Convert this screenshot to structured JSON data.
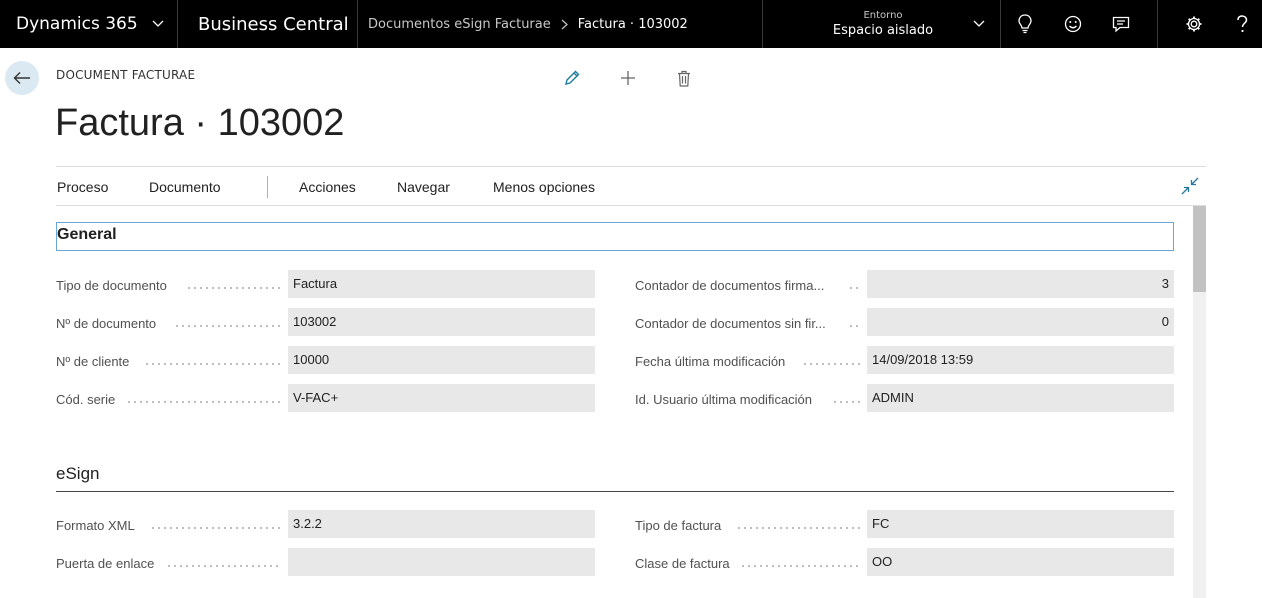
{
  "topbar": {
    "product": "Dynamics 365",
    "app": "Business Central",
    "breadcrumb_parent": "Documentos eSign Facturae",
    "breadcrumb_current": "Factura · 103002",
    "env_label": "Entorno",
    "env_value": "Espacio aislado"
  },
  "header": {
    "caption": "DOCUMENT FACTURAE",
    "title": "Factura · 103002"
  },
  "actions": [
    "Proceso",
    "Documento",
    "Acciones",
    "Navegar",
    "Menos opciones"
  ],
  "general": {
    "title": "General",
    "left": [
      {
        "label": "Tipo de documento",
        "value": "Factura"
      },
      {
        "label": "Nº de documento",
        "value": "103002"
      },
      {
        "label": "Nº de cliente",
        "value": "10000"
      },
      {
        "label": "Cód. serie",
        "value": "V-FAC+"
      }
    ],
    "right": [
      {
        "label": "Contador de documentos firma...",
        "value": "3"
      },
      {
        "label": "Contador de documentos sin fir...",
        "value": "0"
      },
      {
        "label": "Fecha última modificación",
        "value": "14/09/2018 13:59"
      },
      {
        "label": "Id. Usuario última modificación",
        "value": "ADMIN"
      }
    ]
  },
  "esign": {
    "title": "eSign",
    "left": [
      {
        "label": "Formato XML",
        "value": "3.2.2"
      },
      {
        "label": "Puerta de enlace",
        "value": ""
      }
    ],
    "right": [
      {
        "label": "Tipo de factura",
        "value": "FC"
      },
      {
        "label": "Clase de factura",
        "value": "OO"
      }
    ]
  }
}
